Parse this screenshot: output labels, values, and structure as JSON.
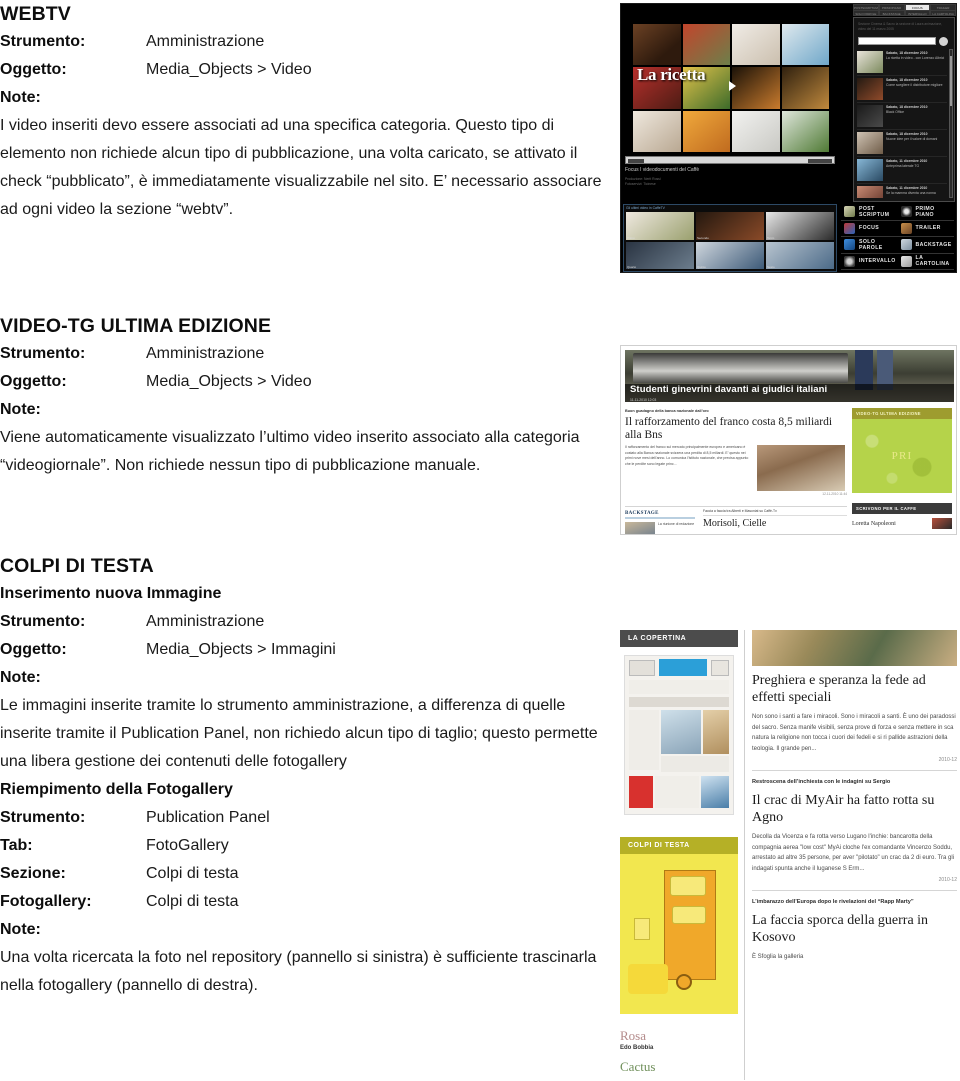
{
  "document": {
    "sections": [
      {
        "id": "webtv",
        "title": "WEBTV",
        "fields": [
          {
            "label": "Strumento:",
            "value": "Amministrazione"
          },
          {
            "label": "Oggetto:",
            "value": "Media_Objects > Video"
          }
        ],
        "note_label": "Note:",
        "note": "I video inseriti devo essere associati ad una specifica categoria. Questo tipo di elemento non richiede alcun tipo di pubblicazione, una volta caricato, se attivato il check “pubblicato”, è immediatamente visualizzabile nel sito. E’ necessario associare ad ogni video la sezione “webtv”."
      },
      {
        "id": "videotg",
        "title": "VIDEO-TG ULTIMA EDIZIONE",
        "fields": [
          {
            "label": "Strumento:",
            "value": "Amministrazione"
          },
          {
            "label": "Oggetto:",
            "value": "Media_Objects > Video"
          }
        ],
        "note_label": "Note:",
        "note": "Viene automaticamente visualizzato l’ultimo video inserito associato alla categoria “videogiornale”. Non richiede nessun tipo di pubblicazione manuale."
      },
      {
        "id": "colpi-di-testa",
        "title": "COLPI DI TESTA",
        "subtitle": "Inserimento nuova Immagine",
        "fields": [
          {
            "label": "Strumento:",
            "value": "Amministrazione"
          },
          {
            "label": "Oggetto:",
            "value": "Media_Objects > Immagini"
          }
        ],
        "note_label": "Note:",
        "note": "Le immagini inserite tramite lo strumento amministrazione, a differenza di quelle inserite tramite il Publication Panel, non richiedo alcun tipo di taglio; questo permette una libera gestione dei contenuti delle fotogallery"
      },
      {
        "id": "riempimento-fotogallery",
        "subtitle": "Riempimento della Fotogallery",
        "fields": [
          {
            "label": "Strumento:",
            "value": "Publication Panel"
          },
          {
            "label": "Tab:",
            "value": "FotoGallery"
          },
          {
            "label": "Sezione:",
            "value": "Colpi di testa"
          },
          {
            "label": "Fotogallery:",
            "value": "Colpi di testa"
          }
        ],
        "note_label": "Note:",
        "note": "Una volta ricercata la foto nel repository (pannello si sinistra) è sufficiente trascinarla nella fotogallery (pannello di destra)."
      }
    ]
  },
  "screenshot_webtv": {
    "tabs_row1": [
      "POSTSCRIPTUM",
      "PRIMOPIANO",
      "FOCUS",
      "TRAILER"
    ],
    "tabs_row2": [
      "SOLO PAROLE",
      "BACKSTAGE",
      "INTERVALLO",
      "LA CARTOLINA"
    ],
    "active_tab": "FOCUS",
    "overlay_title": "La ricetta",
    "caption": "Focus  I videodocumenti del Caffè",
    "credits_line1": "Produzione: Nerit Rossi",
    "credits_line2": "Fotoservizi: Ticinese",
    "panel_intro": "Sezione Cinema & Sacro la sezione di Laura  animazione,  video  del 11 marzo 2005",
    "playlist": [
      {
        "date": "Sabato, 18 dicembre 2010",
        "title": "La ricetta in video  -  con Lorenzo Albrici"
      },
      {
        "date": "Sabato, 18 dicembre 2010",
        "title": "Come scegliere il distributore migliore"
      },
      {
        "date": "Sabato, 18 dicembre 2010",
        "title": "Black Office"
      },
      {
        "date": "Sabato, 18 dicembre 2010",
        "title": "Nuove idee per il valore di domani"
      },
      {
        "date": "Sabato, 11 dicembre 2010",
        "title": "Anteprima laterale TG"
      },
      {
        "date": "Sabato, 11 dicembre 2010",
        "title": "Se la mamma diventa una nonna"
      }
    ],
    "gallery_header": "Gli ultimi video in CaffeTV",
    "gallery_labels": [
      "Primo",
      "Secondo",
      "Terzo",
      "Quarto",
      "Quinto",
      "Sesto"
    ],
    "categories": [
      "POST SCRIPTUM",
      "PRIMO PIANO",
      "FOCUS",
      "TRAILER",
      "SOLO PAROLE",
      "BACKSTAGE",
      "INTERVALLO",
      "LA CARTOLINA"
    ]
  },
  "screenshot_videotg": {
    "hero_title": "Studenti ginevrini davanti ai giudici italiani",
    "hero_date": "11-11-2010 12:03",
    "kicker": "Buon guadagno della banca nazionale dall’oro",
    "headline": "Il rafforzamento del franco costa 8,5 miliardi alla Bns",
    "body": "Il rafforzamento del franco sul mercato principalmente europeo e americano è costato alla Banca nazionale svizzera una perdita di 8,5 miliardi. E' questo nei primi nove mesi dell'anno. Lo comunica l'Istituto nazionale, che precisa appunto che le perdite sono legate princ...",
    "timestamp": "12-11-2010 11:44",
    "backstage_label": "BACKSTAGE",
    "backstage_text": "La riunione di redazione",
    "facetoface_kicker": "Faccia a faccia tra Alberti e Masoniat su Caffè-Tv",
    "facetoface_head": "Morisoli, Cielle",
    "video_box_header": "VIDEO-TG ULTIMA EDIZIONE",
    "video_box_logo": "PRI",
    "authors_header": "SCRIVONO PER IL CAFFE",
    "author_name": "Loretta Napoleoni"
  },
  "screenshot_colpi": {
    "copertina_header": "LA COPERTINA",
    "colpi_header": "COLPI DI TESTA",
    "author1": "Rosa",
    "author1_sub": "Edo Bobbia",
    "author2": "Cactus",
    "articles": [
      {
        "headline": "Preghiera e speranza la fede ad effetti speciali",
        "body": "Non sono i santi a fare i miracoli. Sono i miracoli a santi. È uno dei paradossi del sacro. Senza manife visibili, senza prove di forza e senza mettere in sca natura la religione non tocca i cuori dei fedeli e si ri pallide astrazioni della teologia. Il grande pen...",
        "timestamp": "2010-12"
      },
      {
        "kicker": "Restroscena dell’inchiesta con le indagini su Sergio",
        "headline": "Il crac di MyAir ha fatto rotta su Agno",
        "body": "Decolla da Vicenza e fa rotta verso Lugano l'inchie: bancarotta della compagnia aerea \"low cost\" MyAi cloche l'ex comandante Vincenzo Soddu, arrestato ad altre 35 persone, per aver \"pilotato\" un crac da 2 di euro. Tra gli indagati spunta anche il luganese S Erm...",
        "timestamp": "2010-12"
      },
      {
        "kicker": "L’imbarazzo dell’Europa dopo le rivelazioni del “Rapp Marty”",
        "headline": "La faccia sporca della guerra in Kosovo",
        "body": "È Sfoglia la galleria",
        "timestamp": ""
      }
    ]
  }
}
